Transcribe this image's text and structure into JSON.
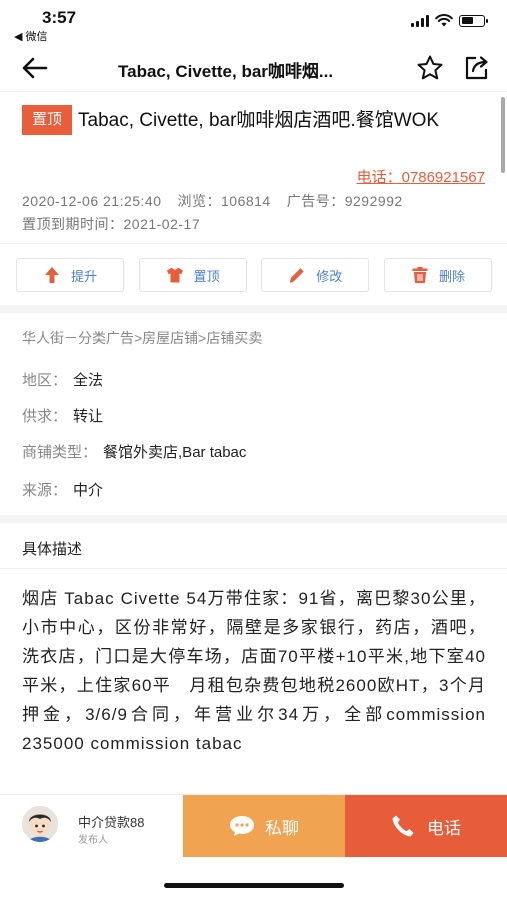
{
  "status_bar": {
    "time": "3:57",
    "back_app": "◀ 微信",
    "battery_level": 0.55
  },
  "nav": {
    "title": "Tabac, Civette, bar咖啡烟...",
    "icons": [
      "back-arrow-icon",
      "star-icon",
      "share-icon"
    ]
  },
  "post": {
    "pin_badge": "置顶",
    "title": "Tabac, Civette, bar咖啡烟店酒吧.餐馆WOK",
    "phone": "电话：0786921567",
    "datetime": "2020-12-06 21:25:40",
    "views": "浏览：106814",
    "ad_no": "广告号：9292992",
    "pin_expiry": "置顶到期时间：2021-02-17"
  },
  "actions": [
    {
      "label": "提升",
      "icon": "arrow-up-icon"
    },
    {
      "label": "置顶",
      "icon": "shirt-icon"
    },
    {
      "label": "修改",
      "icon": "pencil-icon"
    },
    {
      "label": "删除",
      "icon": "trash-icon"
    }
  ],
  "breadcrumb": "华人街－分类广告>房屋店铺>店铺买卖",
  "info": [
    {
      "key": "地区：",
      "value": "全法"
    },
    {
      "key": "供求：",
      "value": "转让"
    },
    {
      "key": "商铺类型：",
      "value": "餐馆外卖店,Bar tabac"
    },
    {
      "key": "来源：",
      "value": "中介"
    }
  ],
  "description": {
    "title": "具体描述",
    "body": "烟店 Tabac Civette 54万带住家：91省，离巴黎30公里，小市中心，区份非常好，隔壁是多家银行，药店，酒吧，洗衣店，门口是大停车场，店面70平楼+10平米,地下室40平米，上住家60平　月租包杂费包地税2600欧HT，3个月押金，3/6/9合同，年营业尔34万，全部commission 235000 commission tabac"
  },
  "footer": {
    "poster_name": "中介贷款88",
    "poster_role": "发布人",
    "chat_label": "私聊",
    "call_label": "电话",
    "chat_color": "#f0a452",
    "call_color": "#e75d3a"
  },
  "colors": {
    "accent": "#e85d3a",
    "action_text": "#4a7fd6",
    "action_icon": "#e85d3a"
  }
}
